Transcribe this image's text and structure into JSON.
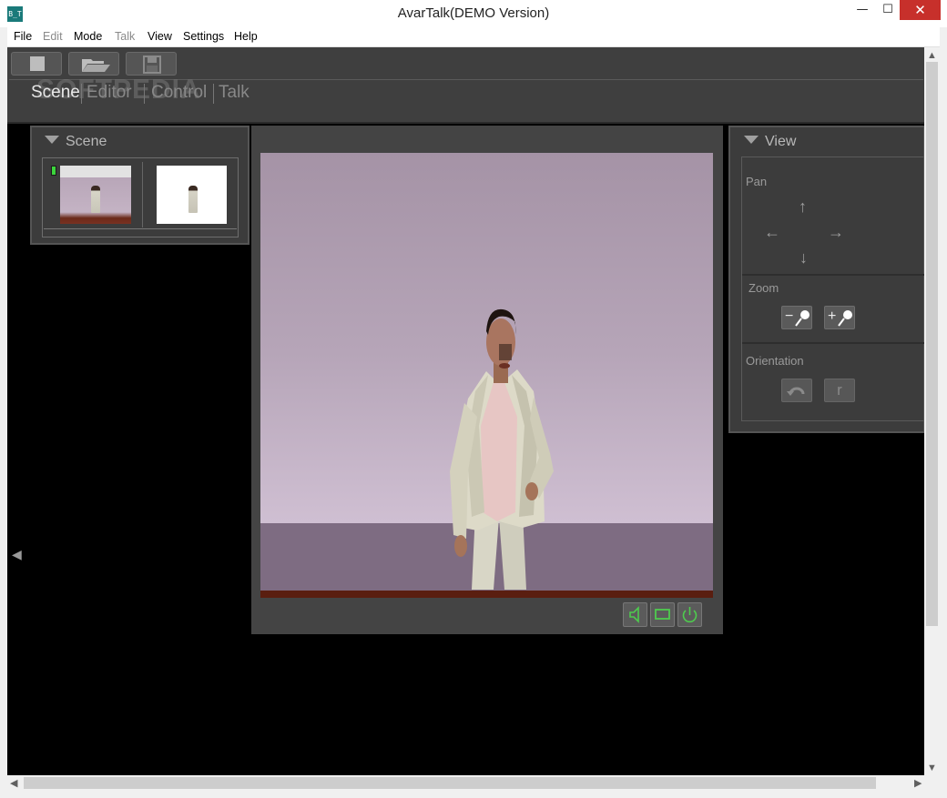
{
  "window": {
    "title": "AvarTalk(DEMO Version)",
    "icon_text": "B_T",
    "min_glyph": "—",
    "max_glyph": "☐",
    "close_glyph": "✕"
  },
  "menu": [
    "File",
    "Edit",
    "Mode",
    "Talk",
    "View",
    "Settings",
    "Help"
  ],
  "modes": {
    "scene": "Scene",
    "editor": "Editor",
    "control": "Control",
    "talk": "Talk"
  },
  "watermark": "SOFTPEDIA",
  "scene_panel": {
    "title": "Scene"
  },
  "view_panel": {
    "title": "View",
    "pan_label": "Pan",
    "zoom_label": "Zoom",
    "orientation_label": "Orientation",
    "zoom_out": "−",
    "zoom_in": "+",
    "orient_reset": "r"
  },
  "icons": {
    "up": "↑",
    "down": "↓",
    "left": "←",
    "right": "→",
    "scroll_up": "▲",
    "scroll_down": "▼",
    "scroll_left": "◀",
    "scroll_right": "▶",
    "collapse": "◀"
  },
  "colors": {
    "panel_bg": "#3c3c3c",
    "accent_green": "#3cd43c",
    "close_red": "#c7302b"
  }
}
